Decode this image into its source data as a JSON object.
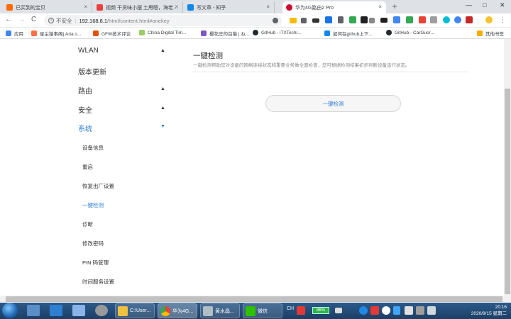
{
  "browser": {
    "tabs": [
      {
        "label": "已买到的宝贝",
        "color": "#ff6a00"
      },
      {
        "label": "视频 干货味小摆 土甩嗯，海老…",
        "color": "#e8423f"
      },
      {
        "label": "写文章 - 知乎",
        "color": "#0f88eb"
      },
      {
        "label": "华为4G路由2 Pro",
        "color": "#cf0a2c"
      }
    ],
    "new_tab": "+",
    "close": "×",
    "window_controls": [
      "—",
      "□",
      "✕"
    ],
    "back": "←",
    "forward": "→",
    "reload": "C",
    "security_label": "不安全",
    "url_host": "192.168.8.1",
    "url_path": "/html/content.html#onekey",
    "bookmarks": [
      {
        "label": "应用",
        "color": "#4285f4"
      },
      {
        "label": "星尘猿事阁| Aria o...",
        "color": "#ff7043"
      },
      {
        "label": "GFW技术评论",
        "color": "#e65100"
      },
      {
        "label": "China Digital Tim...",
        "color": "#9ccc65"
      },
      {
        "label": "樱花庄的白猫 | ね...",
        "color": "#7e57c2"
      },
      {
        "label": "GitHub - iTXTech/...",
        "color": "#24292e"
      },
      {
        "label": "如何在github上下...",
        "color": "#0f88eb"
      },
      {
        "label": "GitHub - CarGuo/...",
        "color": "#24292e"
      },
      {
        "label": "其他书签",
        "color": "#f9ab00"
      }
    ]
  },
  "sidebar": {
    "menus": [
      {
        "label": "WLAN",
        "arrow": "▲",
        "active": false
      },
      {
        "label": "版本更新",
        "arrow": "",
        "active": false
      },
      {
        "label": "路由",
        "arrow": "▲",
        "active": false
      },
      {
        "label": "安全",
        "arrow": "▲",
        "active": false
      },
      {
        "label": "系统",
        "arrow": "▼",
        "active": true
      }
    ],
    "subitems": [
      {
        "label": "设备信息",
        "active": false
      },
      {
        "label": "重启",
        "active": false
      },
      {
        "label": "恢复出厂设置",
        "active": false
      },
      {
        "label": "一键检测",
        "active": true
      },
      {
        "label": "诊断",
        "active": false
      },
      {
        "label": "修改密码",
        "active": false
      },
      {
        "label": "PIN 码管理",
        "active": false
      },
      {
        "label": "时间服务设置",
        "active": false
      }
    ]
  },
  "main": {
    "title": "一键检测",
    "description": "一键检测帮助您对设备的网络连接状态和重要业务做全面检查，您可根据检测结果初步判断设备运行状态。",
    "button_label": "一键检测"
  },
  "taskbar": {
    "tasks": [
      {
        "label": "C:\\User...",
        "color": "#f0c040"
      },
      {
        "label": "华为4G...",
        "color": "#4caf50"
      },
      {
        "label": "黄水晶...",
        "color": "#b0bec5"
      },
      {
        "label": "微信",
        "color": "#2dc100"
      }
    ],
    "tray_ch": "CH",
    "battery": "86%",
    "time": "20:16",
    "date": "2020/9/15 星期二"
  }
}
